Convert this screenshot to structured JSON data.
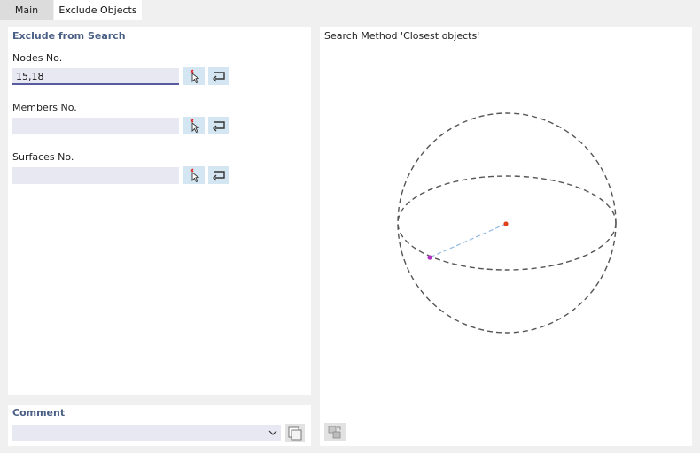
{
  "tabs": [
    {
      "label": "Main",
      "active": false
    },
    {
      "label": "Exclude Objects",
      "active": true
    }
  ],
  "exclude_group": {
    "title": "Exclude from Search",
    "fields": [
      {
        "label": "Nodes No.",
        "value": "15,18"
      },
      {
        "label": "Members No.",
        "value": ""
      },
      {
        "label": "Surfaces No.",
        "value": ""
      }
    ],
    "select_icon": "pick-from-graphic-icon",
    "clear_icon": "reverse-selection-icon"
  },
  "comment": {
    "title": "Comment",
    "value": "",
    "library_icon": "comment-library-icon"
  },
  "preview": {
    "title": "Search Method 'Closest objects'",
    "colors": {
      "sphere_outline": "#555555",
      "center_point": "#e0401a",
      "nearest_point": "#b030c0",
      "radius_line": "#8fb8e0"
    },
    "toolbar_icon": "view-options-icon"
  },
  "colors": {
    "accent_title": "#4a5f85",
    "input_bg": "#e8e8f2",
    "button_bg": "#d5e6f3"
  }
}
